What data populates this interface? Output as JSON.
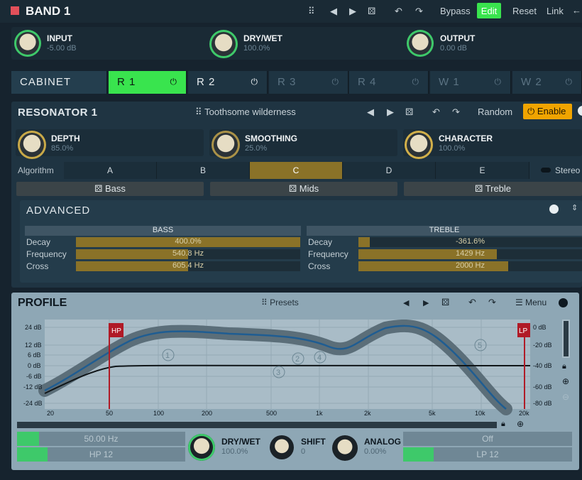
{
  "header": {
    "title": "BAND 1",
    "bypass": "Bypass",
    "edit": "Edit",
    "reset": "Reset",
    "link": "Link"
  },
  "top_knobs": [
    {
      "label": "INPUT",
      "value": "-5.00 dB"
    },
    {
      "label": "DRY/WET",
      "value": "100.0%"
    },
    {
      "label": "OUTPUT",
      "value": "0.00 dB"
    }
  ],
  "tabs": [
    "CABINET",
    "R 1",
    "R 2",
    "R 3",
    "R 4",
    "W 1",
    "W 2"
  ],
  "resonator": {
    "title": "RESONATOR 1",
    "preset": "Toothsome wilderness",
    "random": "Random",
    "enable": "Enable",
    "knobs": [
      {
        "label": "DEPTH",
        "value": "85.0%"
      },
      {
        "label": "SMOOTHING",
        "value": "25.0%"
      },
      {
        "label": "CHARACTER",
        "value": "100.0%"
      }
    ],
    "algorithm_label": "Algorithm",
    "algorithms": [
      "A",
      "B",
      "C",
      "D",
      "E"
    ],
    "algorithm_selected": "C",
    "stereo": "Stereo",
    "buttons": [
      "Bass",
      "Mids",
      "Treble"
    ]
  },
  "advanced": {
    "title": "ADVANCED",
    "bass": {
      "title": "BASS",
      "rows": [
        {
          "label": "Decay",
          "value": "400.0%",
          "fill": 1.0
        },
        {
          "label": "Frequency",
          "value": "540.8 Hz",
          "fill": 0.5
        },
        {
          "label": "Cross",
          "value": "605.4 Hz",
          "fill": 0.5
        }
      ]
    },
    "treble": {
      "title": "TREBLE",
      "rows": [
        {
          "label": "Decay",
          "value": "-361.6%",
          "fill": 0.05
        },
        {
          "label": "Frequency",
          "value": "1429 Hz",
          "fill": 0.6
        },
        {
          "label": "Cross",
          "value": "2000 Hz",
          "fill": 0.66
        }
      ]
    }
  },
  "profile": {
    "title": "PROFILE",
    "presets": "Presets",
    "menu": "Menu",
    "y_left": [
      "24 dB",
      "12 dB",
      "6 dB",
      "0 dB",
      "-6 dB",
      "-12 dB",
      "-24 dB"
    ],
    "y_right": [
      "0 dB",
      "-20 dB",
      "-40 dB",
      "-60 dB",
      "-80 dB"
    ],
    "x_ticks": [
      "20",
      "50",
      "100",
      "200",
      "500",
      "1k",
      "2k",
      "5k",
      "10k",
      "20k"
    ],
    "hp": "HP",
    "lp": "LP",
    "nodes": [
      "1",
      "2",
      "3",
      "4",
      "5"
    ],
    "hp_freq": "50.00 Hz",
    "hp_type": "HP 12",
    "lp_state": "Off",
    "lp_type": "LP 12",
    "knobs": [
      {
        "label": "DRY/WET",
        "value": "100.0%"
      },
      {
        "label": "SHIFT",
        "value": "0"
      },
      {
        "label": "ANALOG",
        "value": "0.00%"
      }
    ]
  },
  "colors": {
    "accent_green": "#39e44e",
    "gold": "#8a7228",
    "enable": "#f0a400"
  }
}
